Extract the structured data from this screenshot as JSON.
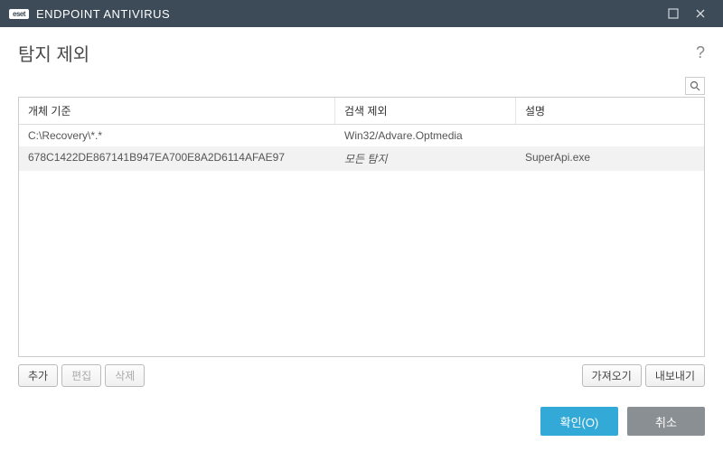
{
  "titlebar": {
    "brand": "eset",
    "product": "ENDPOINT ANTIVIRUS"
  },
  "page": {
    "title": "탐지 제외",
    "help": "?"
  },
  "table": {
    "headers": {
      "object": "개체 기준",
      "detection": "검색 제외",
      "description": "설명"
    },
    "rows": [
      {
        "object": "C:\\Recovery\\*.*",
        "detection": "Win32/Advare.Optmedia",
        "description": ""
      },
      {
        "object": "678C1422DE867141B947EA700E8A2D6114AFAE97",
        "detection": "모든 탐지",
        "description": "SuperApi.exe",
        "detection_italic": true
      }
    ]
  },
  "actions": {
    "add": "추가",
    "edit": "편집",
    "delete": "삭제",
    "import": "가져오기",
    "export": "내보내기"
  },
  "footer": {
    "ok": "확인(O)",
    "cancel": "취소"
  }
}
